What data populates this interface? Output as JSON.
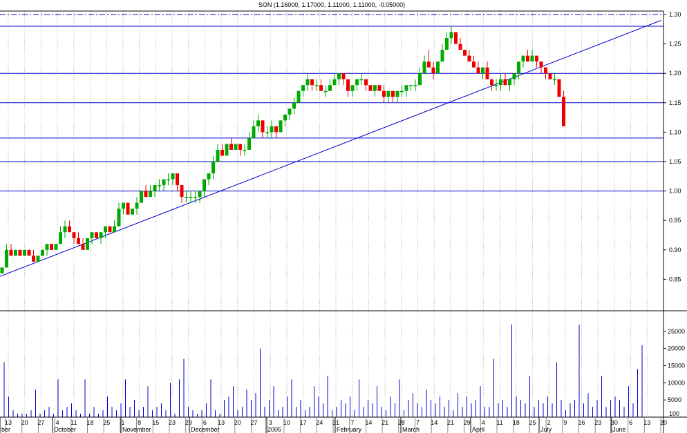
{
  "chart_data": {
    "type": "candlestick",
    "title": "SON (1.16000, 1.17000, 1.11000, 1.11000, -0.05000)",
    "price_axis": {
      "ylim": [
        0.8,
        1.3
      ],
      "ticks": [
        "1.30",
        "1.25",
        "1.20",
        "1.15",
        "1.10",
        "1.05",
        "1.00",
        "0.95",
        "0.90",
        "0.85"
      ]
    },
    "volume_axis": {
      "ylim": [
        0,
        30000
      ],
      "ticks": [
        "25000",
        "20000",
        "15000",
        "10000",
        "5000"
      ],
      "unit_label": "100"
    },
    "horizontal_lines": [
      1.3,
      1.28,
      1.2,
      1.15,
      1.09,
      1.05,
      1.0
    ],
    "dashed_line": 1.3,
    "trendline": {
      "from_index": 0,
      "from_price": 0.855,
      "to_index": 139,
      "to_price": 1.29
    },
    "x_day_labels": [
      "13",
      "20",
      "27",
      "4",
      "11",
      "18",
      "25",
      "1",
      "8",
      "15",
      "23",
      "29",
      "6",
      "13",
      "20",
      "27",
      "3",
      "10",
      "17",
      "24",
      "31",
      "7",
      "14",
      "21",
      "28",
      "7",
      "14",
      "21",
      "29",
      "4",
      "11",
      "18",
      "25",
      "2",
      "9",
      "16",
      "23",
      "30",
      "6",
      "13",
      "20"
    ],
    "x_month_labels": [
      "ber",
      "October",
      "November",
      "December",
      "2005",
      "February",
      "March",
      "April",
      "July",
      "June"
    ],
    "candles": [
      [
        0.86,
        0.87,
        0.86,
        0.87
      ],
      [
        0.87,
        0.91,
        0.87,
        0.9
      ],
      [
        0.9,
        0.91,
        0.89,
        0.89
      ],
      [
        0.89,
        0.9,
        0.89,
        0.9
      ],
      [
        0.9,
        0.9,
        0.89,
        0.89
      ],
      [
        0.89,
        0.9,
        0.89,
        0.9
      ],
      [
        0.9,
        0.9,
        0.89,
        0.89
      ],
      [
        0.89,
        0.9,
        0.88,
        0.88
      ],
      [
        0.88,
        0.89,
        0.88,
        0.89
      ],
      [
        0.89,
        0.9,
        0.89,
        0.9
      ],
      [
        0.9,
        0.91,
        0.89,
        0.91
      ],
      [
        0.91,
        0.91,
        0.9,
        0.9
      ],
      [
        0.9,
        0.91,
        0.9,
        0.91
      ],
      [
        0.91,
        0.94,
        0.91,
        0.93
      ],
      [
        0.93,
        0.95,
        0.92,
        0.94
      ],
      [
        0.94,
        0.95,
        0.93,
        0.93
      ],
      [
        0.93,
        0.93,
        0.91,
        0.92
      ],
      [
        0.92,
        0.93,
        0.91,
        0.91
      ],
      [
        0.91,
        0.92,
        0.9,
        0.9
      ],
      [
        0.9,
        0.92,
        0.9,
        0.92
      ],
      [
        0.92,
        0.93,
        0.91,
        0.93
      ],
      [
        0.93,
        0.93,
        0.92,
        0.92
      ],
      [
        0.92,
        0.93,
        0.91,
        0.93
      ],
      [
        0.93,
        0.94,
        0.92,
        0.94
      ],
      [
        0.94,
        0.94,
        0.93,
        0.93
      ],
      [
        0.93,
        0.95,
        0.93,
        0.94
      ],
      [
        0.94,
        0.98,
        0.94,
        0.97
      ],
      [
        0.97,
        0.98,
        0.96,
        0.98
      ],
      [
        0.98,
        0.98,
        0.96,
        0.96
      ],
      [
        0.96,
        0.97,
        0.96,
        0.97
      ],
      [
        0.97,
        0.99,
        0.96,
        0.98
      ],
      [
        0.98,
        1.0,
        0.98,
        1.0
      ],
      [
        1.0,
        1.01,
        0.99,
        0.99
      ],
      [
        0.99,
        1.01,
        0.99,
        1.0
      ],
      [
        1.0,
        1.01,
        0.99,
        1.01
      ],
      [
        1.01,
        1.02,
        1.0,
        1.01
      ],
      [
        1.01,
        1.02,
        1.0,
        1.02
      ],
      [
        1.02,
        1.03,
        1.01,
        1.02
      ],
      [
        1.02,
        1.03,
        1.01,
        1.03
      ],
      [
        1.03,
        1.03,
        1.0,
        1.01
      ],
      [
        1.01,
        1.01,
        0.98,
        0.99
      ],
      [
        0.99,
        1.0,
        0.98,
        0.99
      ],
      [
        0.99,
        1.0,
        0.98,
        0.99
      ],
      [
        0.99,
        1.0,
        0.98,
        0.99
      ],
      [
        0.99,
        1.0,
        0.98,
        1.0
      ],
      [
        1.0,
        1.02,
        0.99,
        1.02
      ],
      [
        1.02,
        1.03,
        1.01,
        1.03
      ],
      [
        1.03,
        1.06,
        1.02,
        1.05
      ],
      [
        1.05,
        1.08,
        1.05,
        1.07
      ],
      [
        1.07,
        1.08,
        1.06,
        1.06
      ],
      [
        1.06,
        1.08,
        1.06,
        1.08
      ],
      [
        1.08,
        1.09,
        1.07,
        1.07
      ],
      [
        1.07,
        1.08,
        1.07,
        1.08
      ],
      [
        1.08,
        1.08,
        1.06,
        1.07
      ],
      [
        1.07,
        1.08,
        1.06,
        1.07
      ],
      [
        1.07,
        1.1,
        1.07,
        1.09
      ],
      [
        1.09,
        1.12,
        1.09,
        1.11
      ],
      [
        1.11,
        1.13,
        1.1,
        1.12
      ],
      [
        1.12,
        1.12,
        1.09,
        1.1
      ],
      [
        1.1,
        1.11,
        1.09,
        1.1
      ],
      [
        1.1,
        1.12,
        1.09,
        1.11
      ],
      [
        1.11,
        1.11,
        1.09,
        1.1
      ],
      [
        1.1,
        1.12,
        1.1,
        1.12
      ],
      [
        1.12,
        1.13,
        1.11,
        1.13
      ],
      [
        1.13,
        1.14,
        1.12,
        1.14
      ],
      [
        1.14,
        1.16,
        1.13,
        1.15
      ],
      [
        1.15,
        1.17,
        1.15,
        1.17
      ],
      [
        1.17,
        1.18,
        1.16,
        1.18
      ],
      [
        1.18,
        1.2,
        1.17,
        1.19
      ],
      [
        1.19,
        1.19,
        1.17,
        1.18
      ],
      [
        1.18,
        1.19,
        1.17,
        1.18
      ],
      [
        1.18,
        1.19,
        1.17,
        1.17
      ],
      [
        1.17,
        1.18,
        1.16,
        1.17
      ],
      [
        1.17,
        1.19,
        1.17,
        1.18
      ],
      [
        1.18,
        1.2,
        1.18,
        1.19
      ],
      [
        1.19,
        1.2,
        1.18,
        1.2
      ],
      [
        1.2,
        1.2,
        1.18,
        1.19
      ],
      [
        1.19,
        1.19,
        1.16,
        1.17
      ],
      [
        1.17,
        1.18,
        1.16,
        1.18
      ],
      [
        1.18,
        1.19,
        1.17,
        1.19
      ],
      [
        1.19,
        1.2,
        1.18,
        1.19
      ],
      [
        1.19,
        1.19,
        1.17,
        1.18
      ],
      [
        1.18,
        1.18,
        1.17,
        1.17
      ],
      [
        1.17,
        1.18,
        1.16,
        1.18
      ],
      [
        1.18,
        1.18,
        1.17,
        1.17
      ],
      [
        1.17,
        1.18,
        1.15,
        1.16
      ],
      [
        1.16,
        1.17,
        1.15,
        1.17
      ],
      [
        1.17,
        1.17,
        1.15,
        1.16
      ],
      [
        1.16,
        1.17,
        1.15,
        1.17
      ],
      [
        1.17,
        1.18,
        1.16,
        1.17
      ],
      [
        1.17,
        1.18,
        1.16,
        1.18
      ],
      [
        1.18,
        1.18,
        1.17,
        1.18
      ],
      [
        1.18,
        1.19,
        1.17,
        1.18
      ],
      [
        1.18,
        1.21,
        1.18,
        1.2
      ],
      [
        1.2,
        1.23,
        1.2,
        1.22
      ],
      [
        1.22,
        1.24,
        1.21,
        1.21
      ],
      [
        1.21,
        1.22,
        1.19,
        1.2
      ],
      [
        1.2,
        1.22,
        1.2,
        1.22
      ],
      [
        1.22,
        1.25,
        1.22,
        1.24
      ],
      [
        1.24,
        1.27,
        1.24,
        1.26
      ],
      [
        1.26,
        1.28,
        1.25,
        1.27
      ],
      [
        1.27,
        1.27,
        1.25,
        1.25
      ],
      [
        1.25,
        1.26,
        1.24,
        1.24
      ],
      [
        1.24,
        1.24,
        1.23,
        1.23
      ],
      [
        1.23,
        1.24,
        1.22,
        1.22
      ],
      [
        1.22,
        1.23,
        1.21,
        1.21
      ],
      [
        1.21,
        1.22,
        1.2,
        1.2
      ],
      [
        1.2,
        1.21,
        1.19,
        1.21
      ],
      [
        1.21,
        1.22,
        1.19,
        1.19
      ],
      [
        1.19,
        1.19,
        1.17,
        1.18
      ],
      [
        1.18,
        1.19,
        1.17,
        1.18
      ],
      [
        1.18,
        1.2,
        1.17,
        1.19
      ],
      [
        1.19,
        1.2,
        1.18,
        1.18
      ],
      [
        1.18,
        1.19,
        1.17,
        1.19
      ],
      [
        1.19,
        1.2,
        1.18,
        1.2
      ],
      [
        1.2,
        1.22,
        1.19,
        1.22
      ],
      [
        1.22,
        1.23,
        1.21,
        1.23
      ],
      [
        1.23,
        1.24,
        1.22,
        1.22
      ],
      [
        1.22,
        1.24,
        1.22,
        1.23
      ],
      [
        1.23,
        1.23,
        1.21,
        1.22
      ],
      [
        1.22,
        1.22,
        1.2,
        1.21
      ],
      [
        1.21,
        1.21,
        1.19,
        1.2
      ],
      [
        1.2,
        1.2,
        1.19,
        1.19
      ],
      [
        1.19,
        1.2,
        1.18,
        1.19
      ],
      [
        1.19,
        1.19,
        1.16,
        1.16
      ],
      [
        1.16,
        1.17,
        1.11,
        1.11
      ]
    ],
    "volume": [
      16,
      6,
      2,
      1,
      1,
      1,
      2,
      8,
      1,
      2,
      3,
      1,
      11,
      2,
      3,
      4,
      2,
      1,
      11,
      1,
      3,
      1,
      2,
      6,
      3,
      2,
      4,
      11,
      3,
      5,
      2,
      3,
      9,
      2,
      3,
      4,
      2,
      10,
      1,
      11,
      17,
      3,
      2,
      1,
      2,
      4,
      11,
      2,
      1,
      5,
      6,
      9,
      2,
      3,
      8,
      5,
      7,
      20,
      3,
      5,
      9,
      2,
      3,
      6,
      11,
      3,
      5,
      2,
      3,
      9,
      6,
      4,
      12,
      2,
      3,
      5,
      4,
      6,
      2,
      11,
      3,
      5,
      4,
      9,
      3,
      2,
      6,
      4,
      11,
      2,
      5,
      7,
      4,
      3,
      8,
      5,
      4,
      6,
      3,
      5,
      2,
      7,
      3,
      6,
      4,
      5,
      9,
      3,
      3,
      17,
      4,
      5,
      3,
      27,
      6,
      5,
      4,
      12,
      3,
      5,
      4,
      6,
      4,
      16,
      5,
      2,
      4,
      5,
      27,
      4,
      7,
      3,
      5,
      12,
      3,
      5,
      6,
      5,
      3,
      9,
      4,
      14,
      21
    ],
    "colors": {
      "up": "#00aa00",
      "down": "#ee0000",
      "lines": "#0000cc",
      "grid": "#b0b0b0"
    }
  }
}
